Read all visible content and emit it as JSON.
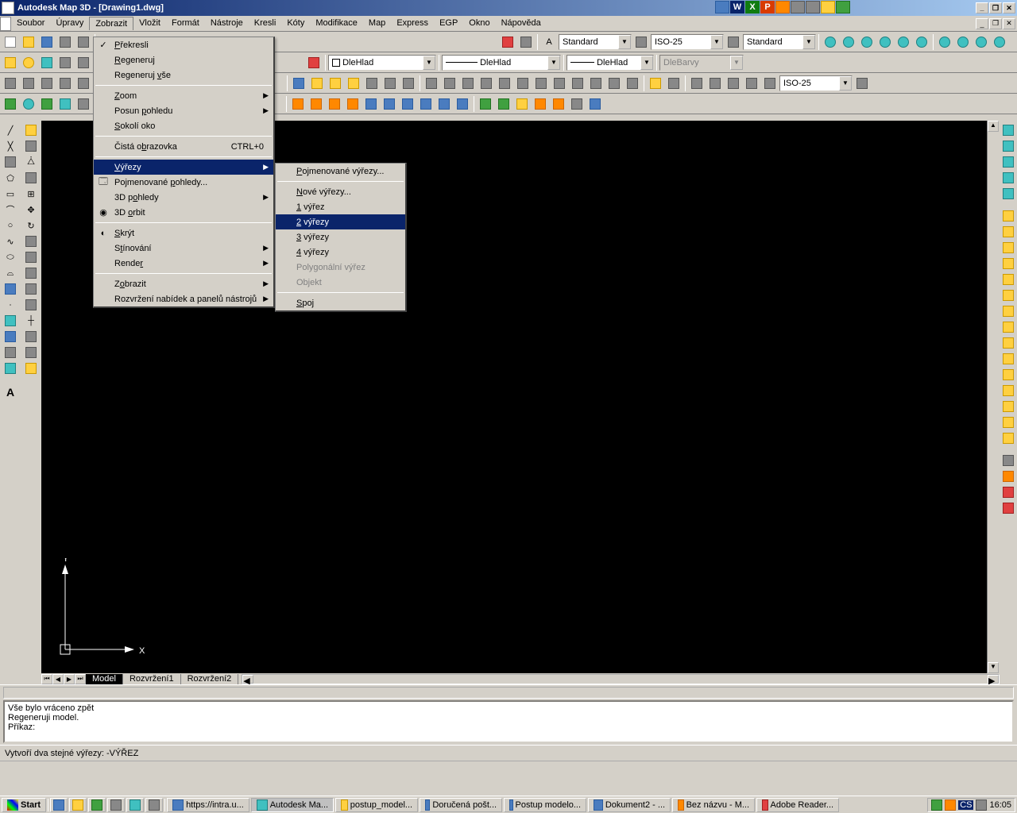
{
  "title": "Autodesk Map 3D - [Drawing1.dwg]",
  "menubar": [
    "Soubor",
    "Úpravy",
    "Zobrazit",
    "Vložit",
    "Formát",
    "Nástroje",
    "Kresli",
    "Kóty",
    "Modifikace",
    "Map",
    "Express",
    "EGP",
    "Okno",
    "Nápověda"
  ],
  "active_menu_index": 2,
  "toolbar2": {
    "style1": "Standard",
    "style2": "ISO-25",
    "style3": "Standard"
  },
  "toolbar3": {
    "layer": "DleHlad",
    "linetype": "DleHlad",
    "lineweight": "DleHlad",
    "color": "DleBarvy"
  },
  "toolbar4": {
    "dim": "ISO-25"
  },
  "dropdown_main": [
    {
      "label": "Překresli",
      "icon": "check",
      "u": 0
    },
    {
      "label": "Regeneruj",
      "u": 0
    },
    {
      "label": "Regeneruj vše",
      "u": 10
    },
    {
      "sep": true
    },
    {
      "label": "Zoom",
      "arrow": true,
      "u": 0
    },
    {
      "label": "Posun pohledu",
      "arrow": true,
      "u": 6
    },
    {
      "label": "Sokolí oko",
      "u": 0
    },
    {
      "sep": true
    },
    {
      "label": "Čistá obrazovka",
      "shortcut": "CTRL+0",
      "u": 7
    },
    {
      "sep": true
    },
    {
      "label": "Výřezy",
      "arrow": true,
      "highlight": true,
      "u": 0
    },
    {
      "label": "Pojmenované pohledy...",
      "icon": "view",
      "u": 12
    },
    {
      "label": "3D pohledy",
      "arrow": true,
      "u": 4
    },
    {
      "label": "3D orbit",
      "icon": "orbit",
      "u": 3
    },
    {
      "sep": true
    },
    {
      "label": "Skrýt",
      "icon": "hide",
      "u": 0
    },
    {
      "label": "Stínování",
      "arrow": true,
      "u": 1
    },
    {
      "label": "Render",
      "arrow": true,
      "u": 5
    },
    {
      "sep": true
    },
    {
      "label": "Zobrazit",
      "arrow": true,
      "u": 1
    },
    {
      "label": "Rozvržení nabídek a panelů nástrojů",
      "arrow": true
    }
  ],
  "dropdown_sub": [
    {
      "label": "Pojmenované výřezy...",
      "u": 0
    },
    {
      "sep": true
    },
    {
      "label": "Nové výřezy...",
      "u": 0
    },
    {
      "label": "1 výřez",
      "u": 0
    },
    {
      "label": "2 výřezy",
      "highlight": true,
      "u": 0
    },
    {
      "label": "3 výřezy",
      "u": 0
    },
    {
      "label": "4 výřezy",
      "u": 0
    },
    {
      "label": "Polygonální výřez",
      "disabled": true
    },
    {
      "label": "Objekt",
      "disabled": true
    },
    {
      "sep": true
    },
    {
      "label": "Spoj",
      "u": 0
    }
  ],
  "tabs": [
    "Model",
    "Rozvržení1",
    "Rozvržení2"
  ],
  "active_tab": 0,
  "cmdline": [
    "Vše bylo vráceno zpět",
    "Regeneruji model.",
    "Příkaz:"
  ],
  "statusbar": "Vytvoří dva stejné výřezy: -VÝŘEZ",
  "ucs": {
    "x": "X",
    "y": "Y"
  },
  "taskbar": {
    "start": "Start",
    "buttons": [
      {
        "label": "https://intra.u...",
        "icon": "ie"
      },
      {
        "label": "Autodesk Ma...",
        "icon": "acad",
        "active": true
      },
      {
        "label": "postup_model...",
        "icon": "folder"
      },
      {
        "label": "Doručená pošt...",
        "icon": "outlook"
      },
      {
        "label": "Postup modelo...",
        "icon": "word"
      },
      {
        "label": "Dokument2 - ...",
        "icon": "word"
      },
      {
        "label": "Bez názvu - M...",
        "icon": "paint"
      },
      {
        "label": "Adobe Reader...",
        "icon": "pdf"
      }
    ],
    "time": "16:05",
    "lang": "CS"
  }
}
